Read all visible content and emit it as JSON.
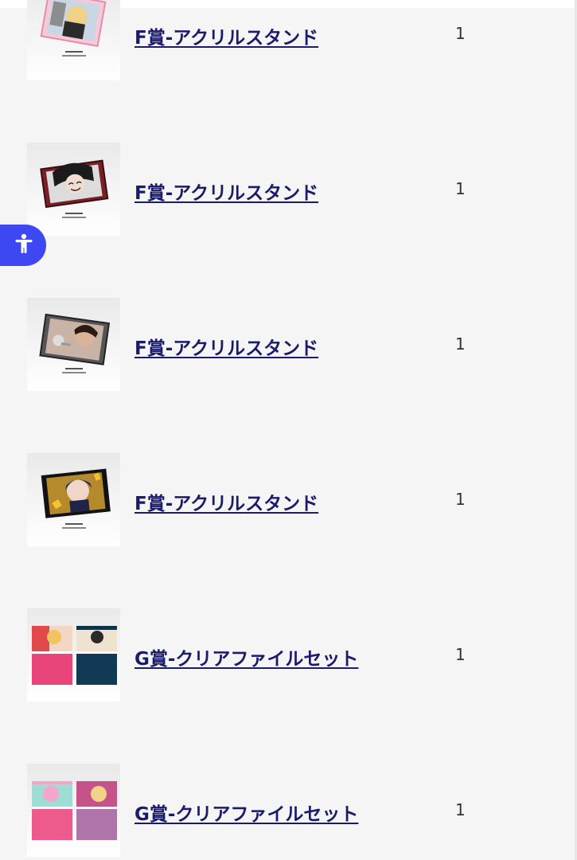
{
  "items": [
    {
      "name": "F賞-アクリルスタンド",
      "qty": "1",
      "thumb": "acrylic-stand-blonde"
    },
    {
      "name": "F賞-アクリルスタンド",
      "qty": "1",
      "thumb": "acrylic-stand-smiling"
    },
    {
      "name": "F賞-アクリルスタンド",
      "qty": "1",
      "thumb": "acrylic-stand-mic"
    },
    {
      "name": "F賞-アクリルスタンド",
      "qty": "1",
      "thumb": "acrylic-stand-blue-hair"
    },
    {
      "name": "G賞-クリアファイルセット",
      "qty": "1",
      "thumb": "clear-file-set-red-navy"
    },
    {
      "name": "G賞-クリアファイルセット",
      "qty": "1",
      "thumb": "clear-file-set-pink-purple"
    }
  ],
  "accessibility": {
    "icon": "accessibility-person-icon",
    "color": "#3d48f2"
  },
  "colors": {
    "link": "#1b1b6b",
    "qty": "#333333",
    "background": "#f5f5f5",
    "file_pink": "#e8457a",
    "file_navy": "#113a55",
    "file_purple": "#b075a8"
  }
}
